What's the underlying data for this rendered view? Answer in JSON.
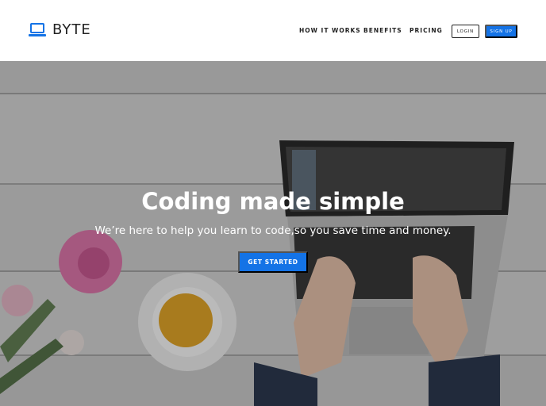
{
  "brand": {
    "name": "BYTE",
    "icon": "laptop-icon",
    "accent": "#1473e6"
  },
  "nav": {
    "links": [
      "HOW IT WORKS",
      "BENEFITS",
      "PRICING"
    ],
    "login_label": "LOGIN",
    "signup_label": "SIGN UP"
  },
  "hero": {
    "title": "Coding made simple",
    "subtitle": "We’re here to help you learn to code,so you save time and money.",
    "cta_label": "GET STARTED",
    "background": "desk-photo-laptop-tea-flowers"
  },
  "colors": {
    "primary": "#1473e6",
    "text": "#222222",
    "nav_bg": "#ffffff"
  }
}
